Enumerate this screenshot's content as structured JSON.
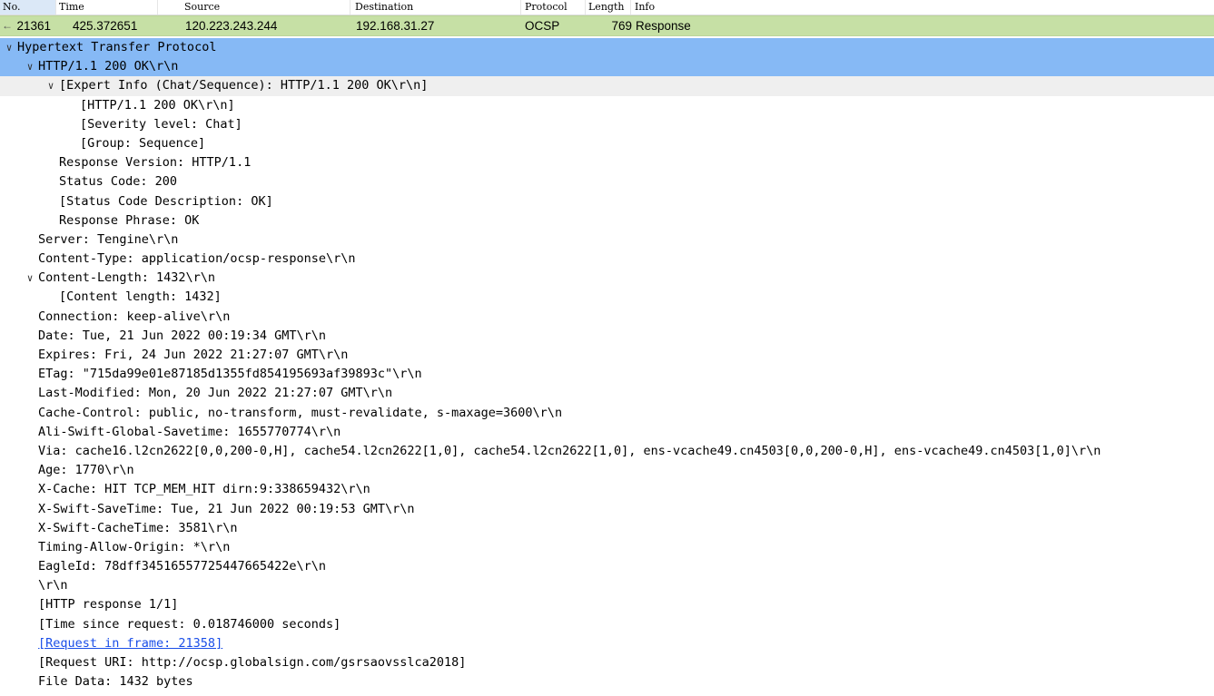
{
  "columns": [
    "No.",
    "Time",
    "Source",
    "Destination",
    "Protocol",
    "Length",
    "Info"
  ],
  "packet": {
    "no": "21361",
    "time": "425.372651",
    "source": "120.223.243.244",
    "destination": "192.168.31.27",
    "protocol": "OCSP",
    "length": "769",
    "info": "Response"
  },
  "tree": [
    {
      "text": "Hypertext Transfer Protocol",
      "depth": 0,
      "toggle": "expanded"
    },
    {
      "text": "HTTP/1.1 200 OK\\r\\n",
      "depth": 1,
      "toggle": "expanded"
    },
    {
      "text": "[Expert Info (Chat/Sequence): HTTP/1.1 200 OK\\r\\n]",
      "depth": 2,
      "toggle": "expanded"
    },
    {
      "text": "[HTTP/1.1 200 OK\\r\\n]",
      "depth": 3,
      "toggle": ""
    },
    {
      "text": "[Severity level: Chat]",
      "depth": 3,
      "toggle": ""
    },
    {
      "text": "[Group: Sequence]",
      "depth": 3,
      "toggle": ""
    },
    {
      "text": "Response Version: HTTP/1.1",
      "depth": 2,
      "toggle": ""
    },
    {
      "text": "Status Code: 200",
      "depth": 2,
      "toggle": ""
    },
    {
      "text": "[Status Code Description: OK]",
      "depth": 2,
      "toggle": ""
    },
    {
      "text": "Response Phrase: OK",
      "depth": 2,
      "toggle": ""
    },
    {
      "text": "Server: Tengine\\r\\n",
      "depth": 1,
      "toggle": ""
    },
    {
      "text": "Content-Type: application/ocsp-response\\r\\n",
      "depth": 1,
      "toggle": ""
    },
    {
      "text": "Content-Length: 1432\\r\\n",
      "depth": 1,
      "toggle": "expanded"
    },
    {
      "text": "[Content length: 1432]",
      "depth": 2,
      "toggle": ""
    },
    {
      "text": "Connection: keep-alive\\r\\n",
      "depth": 1,
      "toggle": ""
    },
    {
      "text": "Date: Tue, 21 Jun 2022 00:19:34 GMT\\r\\n",
      "depth": 1,
      "toggle": ""
    },
    {
      "text": "Expires: Fri, 24 Jun 2022 21:27:07 GMT\\r\\n",
      "depth": 1,
      "toggle": ""
    },
    {
      "text": "ETag: \"715da99e01e87185d1355fd854195693af39893c\"\\r\\n",
      "depth": 1,
      "toggle": ""
    },
    {
      "text": "Last-Modified: Mon, 20 Jun 2022 21:27:07 GMT\\r\\n",
      "depth": 1,
      "toggle": ""
    },
    {
      "text": "Cache-Control: public, no-transform, must-revalidate, s-maxage=3600\\r\\n",
      "depth": 1,
      "toggle": ""
    },
    {
      "text": "Ali-Swift-Global-Savetime: 1655770774\\r\\n",
      "depth": 1,
      "toggle": ""
    },
    {
      "text": "Via: cache16.l2cn2622[0,0,200-0,H], cache54.l2cn2622[1,0], cache54.l2cn2622[1,0], ens-vcache49.cn4503[0,0,200-0,H], ens-vcache49.cn4503[1,0]\\r\\n",
      "depth": 1,
      "toggle": ""
    },
    {
      "text": "Age: 1770\\r\\n",
      "depth": 1,
      "toggle": ""
    },
    {
      "text": "X-Cache: HIT TCP_MEM_HIT dirn:9:338659432\\r\\n",
      "depth": 1,
      "toggle": ""
    },
    {
      "text": "X-Swift-SaveTime: Tue, 21 Jun 2022 00:19:53 GMT\\r\\n",
      "depth": 1,
      "toggle": ""
    },
    {
      "text": "X-Swift-CacheTime: 3581\\r\\n",
      "depth": 1,
      "toggle": ""
    },
    {
      "text": "Timing-Allow-Origin: *\\r\\n",
      "depth": 1,
      "toggle": ""
    },
    {
      "text": "EagleId: 78dff34516557725447665422e\\r\\n",
      "depth": 1,
      "toggle": ""
    },
    {
      "text": "\\r\\n",
      "depth": 1,
      "toggle": ""
    },
    {
      "text": "[HTTP response 1/1]",
      "depth": 1,
      "toggle": ""
    },
    {
      "text": "[Time since request: 0.018746000 seconds]",
      "depth": 1,
      "toggle": ""
    },
    {
      "text": "[Request in frame: 21358]",
      "depth": 1,
      "toggle": "",
      "link": true
    },
    {
      "text": "[Request URI: http://ocsp.globalsign.com/gsrsaovsslca2018]",
      "depth": 1,
      "toggle": ""
    },
    {
      "text": "File Data: 1432 bytes",
      "depth": 1,
      "toggle": ""
    }
  ],
  "colors": {
    "packet_row_bg": "#c6e0a5",
    "selected_bg": "#86b9f5",
    "hover_bg": "#efefef",
    "link": "#1a4ee8"
  }
}
